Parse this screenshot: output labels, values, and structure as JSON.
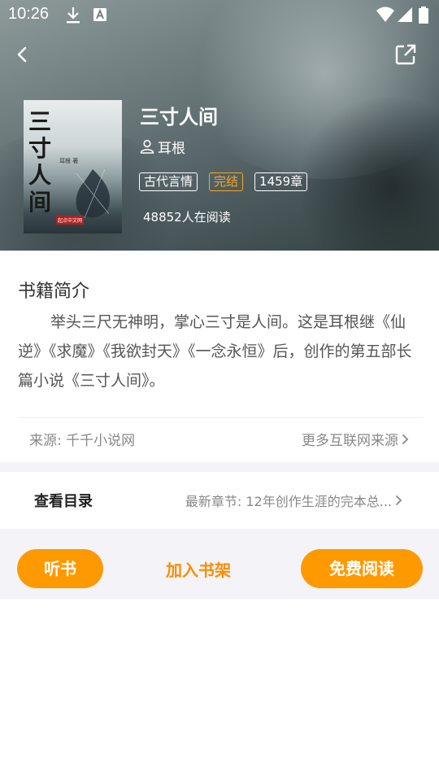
{
  "status_bar": {
    "time": "10:26"
  },
  "book": {
    "cover_title": "三寸人间",
    "cover_author": "耳根 著",
    "cover_logo": "起点中文网",
    "title": "三寸人间",
    "author": "耳根",
    "tags": [
      "古代言情",
      "完结",
      "1459章"
    ],
    "readers": "48852人在阅读"
  },
  "intro": {
    "heading": "书籍简介",
    "text": "举头三尺无神明，掌心三寸是人间。这是耳根继《仙逆》《求魔》《我欲封天》《一念永恒》后，创作的第五部长篇小说《三寸人间》。"
  },
  "source": {
    "label": "来源: 千千小说网",
    "more": "更多互联网来源"
  },
  "toc": {
    "label": "查看目录",
    "latest": "最新章节: 12年创作生涯的完本总..."
  },
  "actions": {
    "listen": "听书",
    "add_shelf": "加入书架",
    "read_free": "免费阅读"
  },
  "colors": {
    "accent": "#ff9900",
    "tag_done": "#f5a623"
  },
  "icons": [
    "download-icon",
    "keyboard-a-icon",
    "wifi-icon",
    "signal-icon",
    "battery-icon",
    "back-icon",
    "share-icon",
    "person-icon",
    "chevron-right-icon"
  ]
}
